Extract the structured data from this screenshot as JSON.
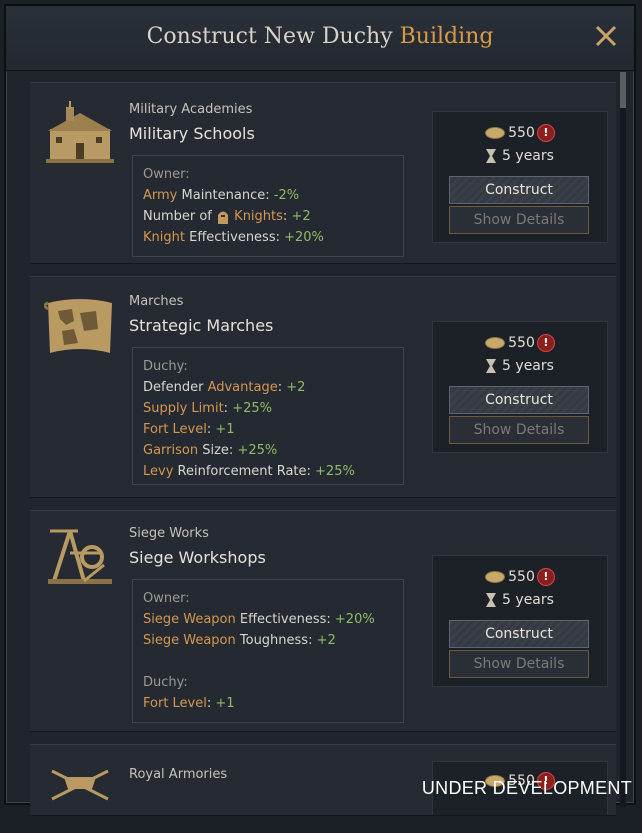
{
  "window": {
    "title_main": "Construct New Duchy",
    "title_accent": "Building"
  },
  "cards": [
    {
      "category": "Military Academies",
      "name": "Military Schools",
      "icon": "military-academy-icon",
      "gold": "550",
      "time": "5 years",
      "construct_label": "Construct",
      "details_label": "Show Details",
      "groups": [
        {
          "header": "Owner:",
          "lines": [
            {
              "key": "Army",
              "text": " Maintenance: ",
              "val": "-2%"
            },
            {
              "pre": "Number of ",
              "key": "Knights",
              "text": ": ",
              "val": "+2",
              "icon": "knight-helmet-icon"
            },
            {
              "key": "Knight",
              "text": " Effectiveness: ",
              "val": "+20%"
            }
          ]
        }
      ]
    },
    {
      "category": "Marches",
      "name": "Strategic Marches",
      "icon": "map-scroll-icon",
      "gold": "550",
      "time": "5 years",
      "construct_label": "Construct",
      "details_label": "Show Details",
      "groups": [
        {
          "header": "Duchy:",
          "lines": [
            {
              "pre": "Defender ",
              "key": "Advantage",
              "text": ": ",
              "val": "+2"
            },
            {
              "key": "Supply Limit",
              "text": ": ",
              "val": "+25%"
            },
            {
              "key": "Fort Level",
              "text": ": ",
              "val": "+1"
            },
            {
              "key": "Garrison",
              "text": " Size: ",
              "val": "+25%"
            },
            {
              "key": "Levy",
              "text": " Reinforcement Rate: ",
              "val": "+25%"
            }
          ]
        }
      ]
    },
    {
      "category": "Siege Works",
      "name": "Siege Workshops",
      "icon": "siege-engine-icon",
      "gold": "550",
      "time": "5 years",
      "construct_label": "Construct",
      "details_label": "Show Details",
      "groups": [
        {
          "header": "Owner:",
          "lines": [
            {
              "key": "Siege Weapon",
              "text": " Effectiveness: ",
              "val": "+20%"
            },
            {
              "key": "Siege Weapon",
              "text": " Toughness: ",
              "val": "+2"
            }
          ]
        },
        {
          "header": "Duchy:",
          "lines": [
            {
              "key": "Fort Level",
              "text": ": ",
              "val": "+1"
            }
          ]
        }
      ]
    },
    {
      "category": "Royal Armories",
      "icon": "armory-icon",
      "gold": "550"
    }
  ],
  "watermark": "UNDER DEVELOPMENT",
  "colors": {
    "accent": "#d99b4a",
    "positive": "#8fbc66",
    "keyword": "#d49850",
    "warning": "#8b1f1f"
  }
}
